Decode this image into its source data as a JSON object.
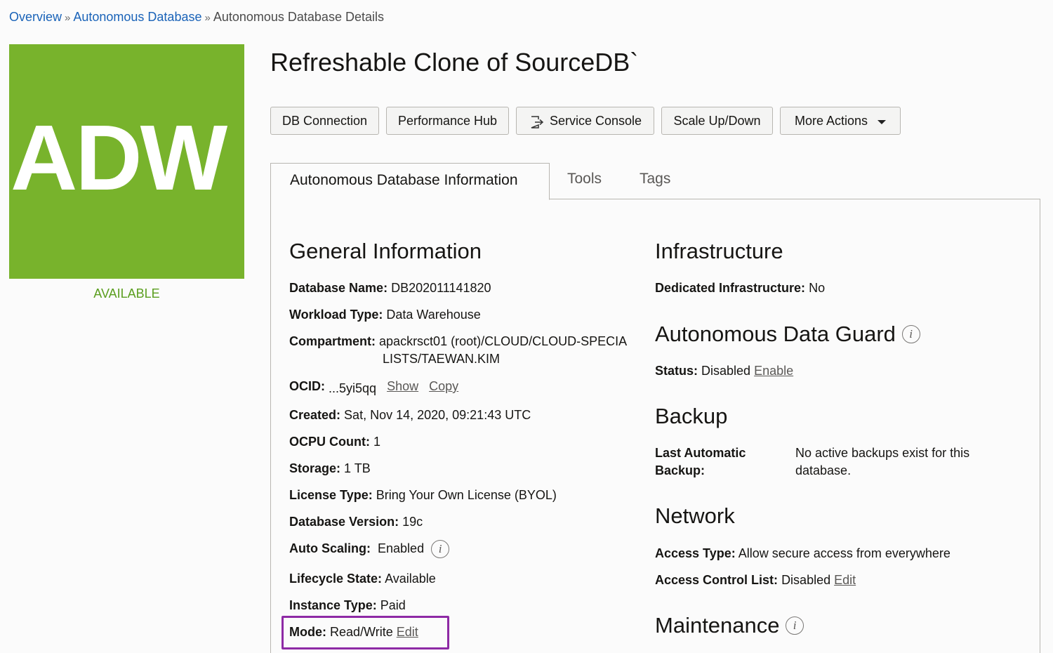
{
  "breadcrumb": {
    "items": [
      "Overview",
      "Autonomous Database"
    ],
    "separator": "»",
    "current": "Autonomous Database Details"
  },
  "logo": {
    "text": "ADW",
    "color": "#78b32c"
  },
  "lifecycle_badge": "AVAILABLE",
  "page_title": "Refreshable Clone of SourceDB`",
  "toolbar": {
    "db_connection": "DB Connection",
    "performance_hub": "Performance Hub",
    "service_console": "Service Console",
    "scale": "Scale Up/Down",
    "more_actions": "More Actions"
  },
  "tabs": {
    "info": "Autonomous Database Information",
    "tools": "Tools",
    "tags": "Tags"
  },
  "general": {
    "heading": "General Information",
    "database_name": {
      "label": "Database Name:",
      "value": "DB202011141820"
    },
    "workload_type": {
      "label": "Workload Type:",
      "value": "Data Warehouse"
    },
    "compartment": {
      "label": "Compartment:",
      "value_line1": "apackrsct01 (root)/CLOUD/CLOUD-SPECIA",
      "value_line2": "LISTS/TAEWAN.KIM"
    },
    "ocid": {
      "label": "OCID:",
      "value": "...5yi5qq",
      "show": "Show",
      "copy": "Copy"
    },
    "created": {
      "label": "Created:",
      "value": "Sat, Nov 14, 2020, 09:21:43 UTC"
    },
    "ocpu_count": {
      "label": "OCPU Count:",
      "value": "1"
    },
    "storage": {
      "label": "Storage:",
      "value": "1 TB"
    },
    "license_type": {
      "label": "License Type:",
      "value": "Bring Your Own License (BYOL)"
    },
    "database_version": {
      "label": "Database Version:",
      "value": "19c"
    },
    "auto_scaling": {
      "label": "Auto Scaling:",
      "value": "Enabled"
    },
    "lifecycle_state": {
      "label": "Lifecycle State:",
      "value": "Available"
    },
    "instance_type": {
      "label": "Instance Type:",
      "value": "Paid"
    },
    "mode": {
      "label": "Mode:",
      "value": "Read/Write",
      "edit": "Edit"
    }
  },
  "infrastructure": {
    "heading": "Infrastructure",
    "dedicated": {
      "label": "Dedicated Infrastructure:",
      "value": "No"
    }
  },
  "data_guard": {
    "heading": "Autonomous Data Guard",
    "status": {
      "label": "Status:",
      "value": "Disabled",
      "action": "Enable"
    }
  },
  "backup": {
    "heading": "Backup",
    "last_label_line1": "Last Automatic",
    "last_label_line2": "Backup:",
    "last_value_line1": "No active backups exist for this",
    "last_value_line2": "database."
  },
  "network": {
    "heading": "Network",
    "access_type": {
      "label": "Access Type:",
      "value": "Allow secure access from everywhere"
    },
    "acl": {
      "label": "Access Control List:",
      "value": "Disabled",
      "edit": "Edit"
    }
  },
  "maintenance": {
    "heading": "Maintenance"
  },
  "info_glyph": "i",
  "highlight_color": "#8e2aa5"
}
